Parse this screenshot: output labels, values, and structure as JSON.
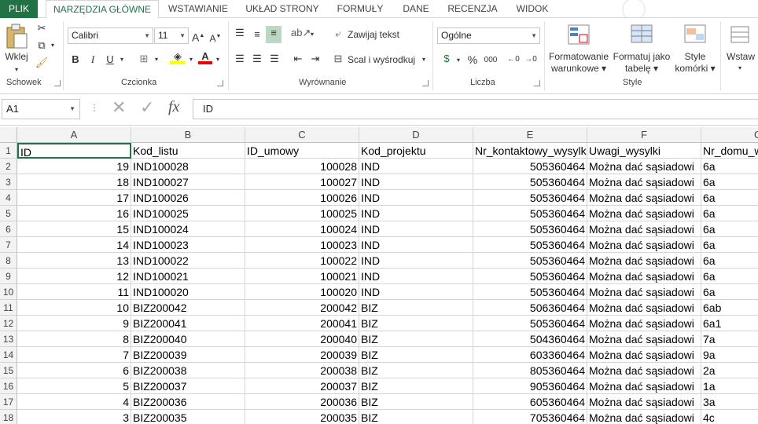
{
  "tabs": [
    "PLIK",
    "NARZĘDZIA GŁÓWNE",
    "WSTAWIANIE",
    "UKŁAD STRONY",
    "FORMUŁY",
    "DANE",
    "RECENZJA",
    "WIDOK"
  ],
  "ribbon": {
    "clipboard": {
      "paste": "Wklej",
      "label": "Schowek"
    },
    "font": {
      "name": "Calibri",
      "size": "11",
      "label": "Czcionka",
      "bold": "B",
      "italic": "I",
      "underline": "U"
    },
    "alignment": {
      "wrap": "Zawijaj tekst",
      "merge": "Scal i wyśrodkuj",
      "label": "Wyrównanie"
    },
    "number": {
      "format": "Ogólne",
      "label": "Liczba",
      "percent": "%",
      "thousands": "000"
    },
    "styles": {
      "conditional_1": "Formatowanie",
      "conditional_2": "warunkowe",
      "table_1": "Formatuj jako",
      "table_2": "tabelę",
      "cell_1": "Style",
      "cell_2": "komórki",
      "label": "Style"
    },
    "cells": {
      "insert": "Wstaw"
    }
  },
  "formula_bar": {
    "name_box": "A1",
    "content": "ID",
    "fx": "fx"
  },
  "columns": [
    "A",
    "B",
    "C",
    "D",
    "E",
    "F",
    "G"
  ],
  "header_row": [
    "ID",
    "Kod_listu",
    "ID_umowy",
    "Kod_projektu",
    "Nr_kontaktowy_wysylki",
    "Uwagi_wysylki",
    "Nr_domu_w"
  ],
  "rows": [
    {
      "n": "2",
      "id": "19",
      "kod": "IND100028",
      "umowa": "100028",
      "proj": "IND",
      "tel": "505360464",
      "uwagi": "Można dać sąsiadowi",
      "dom": "6a"
    },
    {
      "n": "3",
      "id": "18",
      "kod": "IND100027",
      "umowa": "100027",
      "proj": "IND",
      "tel": "505360464",
      "uwagi": "Można dać sąsiadowi",
      "dom": "6a"
    },
    {
      "n": "4",
      "id": "17",
      "kod": "IND100026",
      "umowa": "100026",
      "proj": "IND",
      "tel": "505360464",
      "uwagi": "Można dać sąsiadowi",
      "dom": "6a"
    },
    {
      "n": "5",
      "id": "16",
      "kod": "IND100025",
      "umowa": "100025",
      "proj": "IND",
      "tel": "505360464",
      "uwagi": "Można dać sąsiadowi",
      "dom": "6a"
    },
    {
      "n": "6",
      "id": "15",
      "kod": "IND100024",
      "umowa": "100024",
      "proj": "IND",
      "tel": "505360464",
      "uwagi": "Można dać sąsiadowi",
      "dom": "6a"
    },
    {
      "n": "7",
      "id": "14",
      "kod": "IND100023",
      "umowa": "100023",
      "proj": "IND",
      "tel": "505360464",
      "uwagi": "Można dać sąsiadowi",
      "dom": "6a"
    },
    {
      "n": "8",
      "id": "13",
      "kod": "IND100022",
      "umowa": "100022",
      "proj": "IND",
      "tel": "505360464",
      "uwagi": "Można dać sąsiadowi",
      "dom": "6a"
    },
    {
      "n": "9",
      "id": "12",
      "kod": "IND100021",
      "umowa": "100021",
      "proj": "IND",
      "tel": "505360464",
      "uwagi": "Można dać sąsiadowi",
      "dom": "6a"
    },
    {
      "n": "10",
      "id": "11",
      "kod": "IND100020",
      "umowa": "100020",
      "proj": "IND",
      "tel": "505360464",
      "uwagi": "Można dać sąsiadowi",
      "dom": "6a"
    },
    {
      "n": "11",
      "id": "10",
      "kod": "BIZ200042",
      "umowa": "200042",
      "proj": "BIZ",
      "tel": "506360464",
      "uwagi": "Można dać sąsiadowi",
      "dom": "6ab"
    },
    {
      "n": "12",
      "id": "9",
      "kod": "BIZ200041",
      "umowa": "200041",
      "proj": "BIZ",
      "tel": "505360464",
      "uwagi": "Można dać sąsiadowi",
      "dom": "6a1"
    },
    {
      "n": "13",
      "id": "8",
      "kod": "BIZ200040",
      "umowa": "200040",
      "proj": "BIZ",
      "tel": "504360464",
      "uwagi": "Można dać sąsiadowi",
      "dom": "7a"
    },
    {
      "n": "14",
      "id": "7",
      "kod": "BIZ200039",
      "umowa": "200039",
      "proj": "BIZ",
      "tel": "603360464",
      "uwagi": "Można dać sąsiadowi",
      "dom": "9a"
    },
    {
      "n": "15",
      "id": "6",
      "kod": "BIZ200038",
      "umowa": "200038",
      "proj": "BIZ",
      "tel": "805360464",
      "uwagi": "Można dać sąsiadowi",
      "dom": "2a"
    },
    {
      "n": "16",
      "id": "5",
      "kod": "BIZ200037",
      "umowa": "200037",
      "proj": "BIZ",
      "tel": "905360464",
      "uwagi": "Można dać sąsiadowi",
      "dom": "1a"
    },
    {
      "n": "17",
      "id": "4",
      "kod": "BIZ200036",
      "umowa": "200036",
      "proj": "BIZ",
      "tel": "605360464",
      "uwagi": "Można dać sąsiadowi",
      "dom": "3a"
    },
    {
      "n": "18",
      "id": "3",
      "kod": "BIZ200035",
      "umowa": "200035",
      "proj": "BIZ",
      "tel": "705360464",
      "uwagi": "Można dać sąsiadowi",
      "dom": "4c"
    }
  ],
  "colors": {
    "brand": "#217346",
    "header_bg": "#f3f3f3",
    "grid_line": "#d4d4d4"
  }
}
